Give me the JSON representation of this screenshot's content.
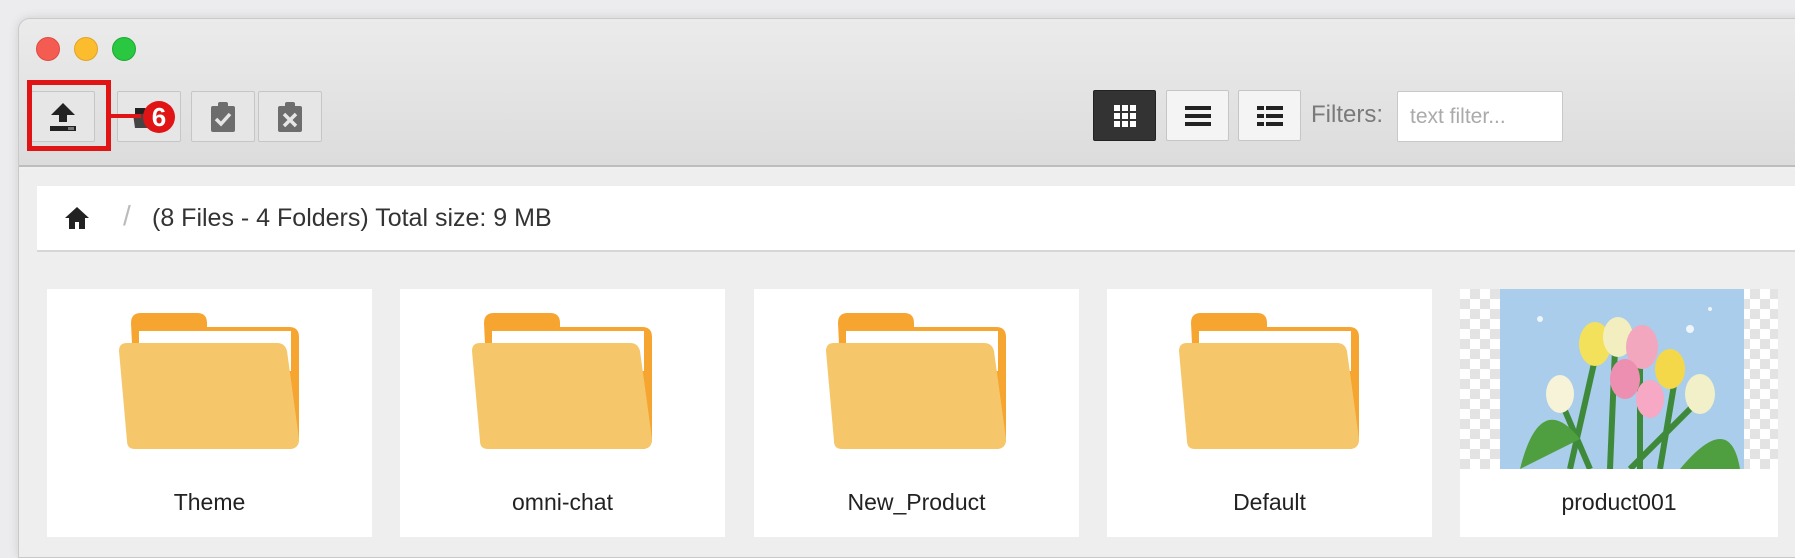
{
  "toolbar": {
    "upload_icon": "upload-icon",
    "callout_number": "6",
    "buttons": [
      "upload-icon",
      "folder-icon",
      "clipboard-check-icon",
      "clipboard-x-icon"
    ]
  },
  "view_modes": [
    "grid-view-icon",
    "list-view-icon",
    "detail-view-icon"
  ],
  "filters": {
    "label": "Filters:",
    "placeholder": "text filter...",
    "value": ""
  },
  "breadcrumb": {
    "separator": "/",
    "summary": "(8 Files - 4 Folders) Total size: 9 MB"
  },
  "items": [
    {
      "name": "Theme",
      "type": "folder"
    },
    {
      "name": "omni-chat",
      "type": "folder"
    },
    {
      "name": "New_Product",
      "type": "folder"
    },
    {
      "name": "Default",
      "type": "folder"
    },
    {
      "name": "product001",
      "type": "image"
    }
  ],
  "colors": {
    "folder_front": "#f5c76a",
    "folder_back": "#f6a531",
    "highlight": "#e01414",
    "active_view": "#333333"
  }
}
